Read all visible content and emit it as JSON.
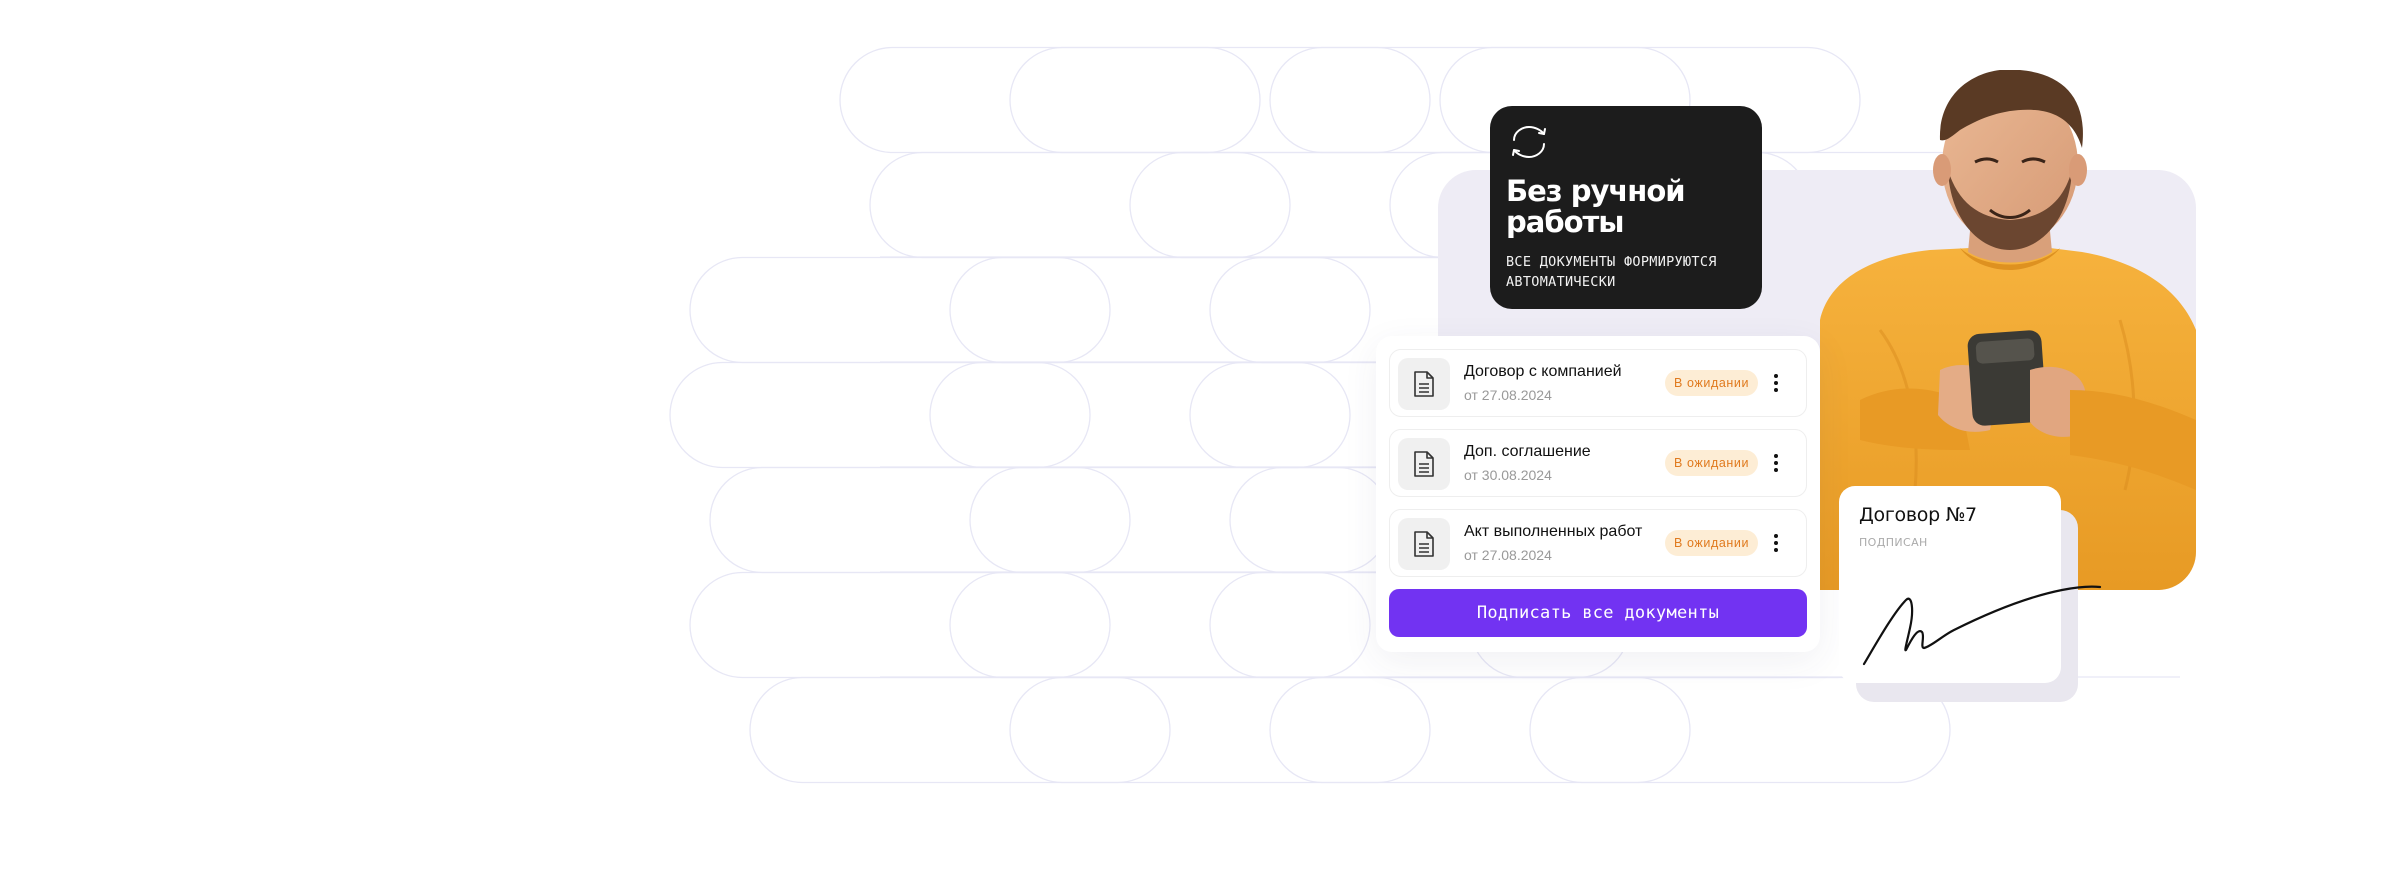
{
  "promo": {
    "icon": "cycle-arrows-icon",
    "title": "Без ручной работы",
    "subtitle_line1": "ВСЕ ДОКУМЕНТЫ ФОРМИРУЮТСЯ",
    "subtitle_line2": "АВТОМАТИЧЕСКИ"
  },
  "documents": [
    {
      "title": "Договор с компанией",
      "date": "от 27.08.2024",
      "status": "В ожидании",
      "icon": "document-icon"
    },
    {
      "title": "Доп. соглашение",
      "date": "от 30.08.2024",
      "status": "В ожидании",
      "icon": "document-icon"
    },
    {
      "title": "Акт выполненных работ",
      "date": "от 27.08.2024",
      "status": "В ожидании",
      "icon": "document-icon"
    }
  ],
  "sign_all_button": "Подписать все документы",
  "signed_card": {
    "title": "Договор №7",
    "status": "ПОДПИСАН"
  },
  "colors": {
    "accent": "#7233f2",
    "status_bg": "#fdedd5",
    "status_text": "#e07a1e",
    "dark_card": "#1c1c1c",
    "panel_lavender": "#eeecf5",
    "sweater": "#f2a531"
  }
}
